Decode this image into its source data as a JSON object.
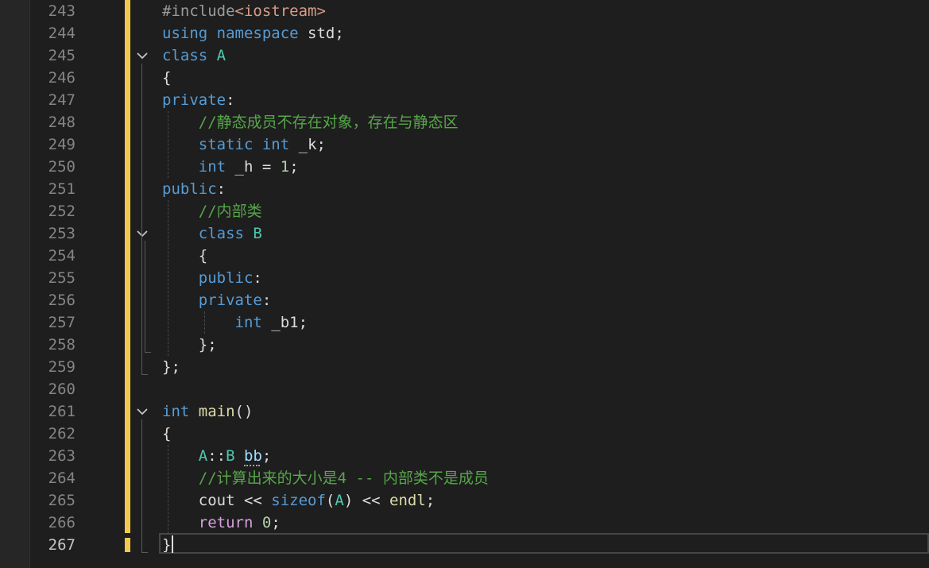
{
  "editor": {
    "current_line": 267,
    "lines": [
      {
        "num": "243",
        "tokens": [
          {
            "t": "#include",
            "c": "pp"
          },
          {
            "t": "<iostream>",
            "c": "str"
          }
        ]
      },
      {
        "num": "244",
        "tokens": [
          {
            "t": "using",
            "c": "kw"
          },
          {
            "t": " ",
            "c": "plain"
          },
          {
            "t": "namespace",
            "c": "kw"
          },
          {
            "t": " std;",
            "c": "plain"
          }
        ]
      },
      {
        "num": "245",
        "tokens": [
          {
            "t": "class",
            "c": "kw"
          },
          {
            "t": " ",
            "c": "plain"
          },
          {
            "t": "A",
            "c": "cls"
          }
        ]
      },
      {
        "num": "246",
        "tokens": [
          {
            "t": "{",
            "c": "plain"
          }
        ]
      },
      {
        "num": "247",
        "tokens": [
          {
            "t": "private",
            "c": "kw"
          },
          {
            "t": ":",
            "c": "plain"
          }
        ]
      },
      {
        "num": "248",
        "tokens": [
          {
            "t": "    ",
            "c": "plain"
          },
          {
            "t": "//静态成员不存在对象，存在与静态区",
            "c": "cmt"
          }
        ]
      },
      {
        "num": "249",
        "tokens": [
          {
            "t": "    ",
            "c": "plain"
          },
          {
            "t": "static",
            "c": "kw"
          },
          {
            "t": " ",
            "c": "plain"
          },
          {
            "t": "int",
            "c": "kw"
          },
          {
            "t": " _k;",
            "c": "plain"
          }
        ]
      },
      {
        "num": "250",
        "tokens": [
          {
            "t": "    ",
            "c": "plain"
          },
          {
            "t": "int",
            "c": "kw"
          },
          {
            "t": " _h = ",
            "c": "plain"
          },
          {
            "t": "1",
            "c": "num"
          },
          {
            "t": ";",
            "c": "plain"
          }
        ]
      },
      {
        "num": "251",
        "tokens": [
          {
            "t": "public",
            "c": "kw"
          },
          {
            "t": ":",
            "c": "plain"
          }
        ]
      },
      {
        "num": "252",
        "tokens": [
          {
            "t": "    ",
            "c": "plain"
          },
          {
            "t": "//内部类",
            "c": "cmt"
          }
        ]
      },
      {
        "num": "253",
        "tokens": [
          {
            "t": "    ",
            "c": "plain"
          },
          {
            "t": "class",
            "c": "kw"
          },
          {
            "t": " ",
            "c": "plain"
          },
          {
            "t": "B",
            "c": "cls"
          }
        ]
      },
      {
        "num": "254",
        "tokens": [
          {
            "t": "    {",
            "c": "plain"
          }
        ]
      },
      {
        "num": "255",
        "tokens": [
          {
            "t": "    ",
            "c": "plain"
          },
          {
            "t": "public",
            "c": "kw"
          },
          {
            "t": ":",
            "c": "plain"
          }
        ]
      },
      {
        "num": "256",
        "tokens": [
          {
            "t": "    ",
            "c": "plain"
          },
          {
            "t": "private",
            "c": "kw"
          },
          {
            "t": ":",
            "c": "plain"
          }
        ]
      },
      {
        "num": "257",
        "tokens": [
          {
            "t": "        ",
            "c": "plain"
          },
          {
            "t": "int",
            "c": "kw"
          },
          {
            "t": " _b1;",
            "c": "plain"
          }
        ]
      },
      {
        "num": "258",
        "tokens": [
          {
            "t": "    };",
            "c": "plain"
          }
        ]
      },
      {
        "num": "259",
        "tokens": [
          {
            "t": "};",
            "c": "plain"
          }
        ]
      },
      {
        "num": "260",
        "tokens": []
      },
      {
        "num": "261",
        "tokens": [
          {
            "t": "int",
            "c": "kw"
          },
          {
            "t": " ",
            "c": "plain"
          },
          {
            "t": "main",
            "c": "fn"
          },
          {
            "t": "()",
            "c": "plain"
          }
        ]
      },
      {
        "num": "262",
        "tokens": [
          {
            "t": "{",
            "c": "plain"
          }
        ]
      },
      {
        "num": "263",
        "tokens": [
          {
            "t": "    ",
            "c": "plain"
          },
          {
            "t": "A",
            "c": "cls"
          },
          {
            "t": "::",
            "c": "plain"
          },
          {
            "t": "B",
            "c": "cls"
          },
          {
            "t": " ",
            "c": "plain"
          },
          {
            "t": "bb",
            "c": "var"
          },
          {
            "t": ";",
            "c": "plain"
          }
        ]
      },
      {
        "num": "264",
        "tokens": [
          {
            "t": "    ",
            "c": "plain"
          },
          {
            "t": "//计算出来的大小是4 -- 内部类不是成员",
            "c": "cmt"
          }
        ]
      },
      {
        "num": "265",
        "tokens": [
          {
            "t": "    cout << ",
            "c": "plain"
          },
          {
            "t": "sizeof",
            "c": "kw"
          },
          {
            "t": "(",
            "c": "plain"
          },
          {
            "t": "A",
            "c": "cls"
          },
          {
            "t": ") << ",
            "c": "plain"
          },
          {
            "t": "endl",
            "c": "fn"
          },
          {
            "t": ";",
            "c": "plain"
          }
        ]
      },
      {
        "num": "266",
        "tokens": [
          {
            "t": "    ",
            "c": "plain"
          },
          {
            "t": "return",
            "c": "ctl"
          },
          {
            "t": " ",
            "c": "plain"
          },
          {
            "t": "0",
            "c": "num"
          },
          {
            "t": ";",
            "c": "plain"
          }
        ]
      },
      {
        "num": "267",
        "tokens": [
          {
            "t": "}",
            "c": "plain"
          }
        ]
      }
    ],
    "fold_toggles": [
      "245",
      "253",
      "261"
    ]
  },
  "colors": {
    "background": "#1e1e1e",
    "keyword": "#569cd6",
    "type_name": "#4ec9b0",
    "comment": "#57a64a",
    "string": "#d69d85",
    "function": "#dcdcaa",
    "number": "#b5cea8",
    "control": "#d8a0df",
    "change_marker": "#f2c94c"
  }
}
